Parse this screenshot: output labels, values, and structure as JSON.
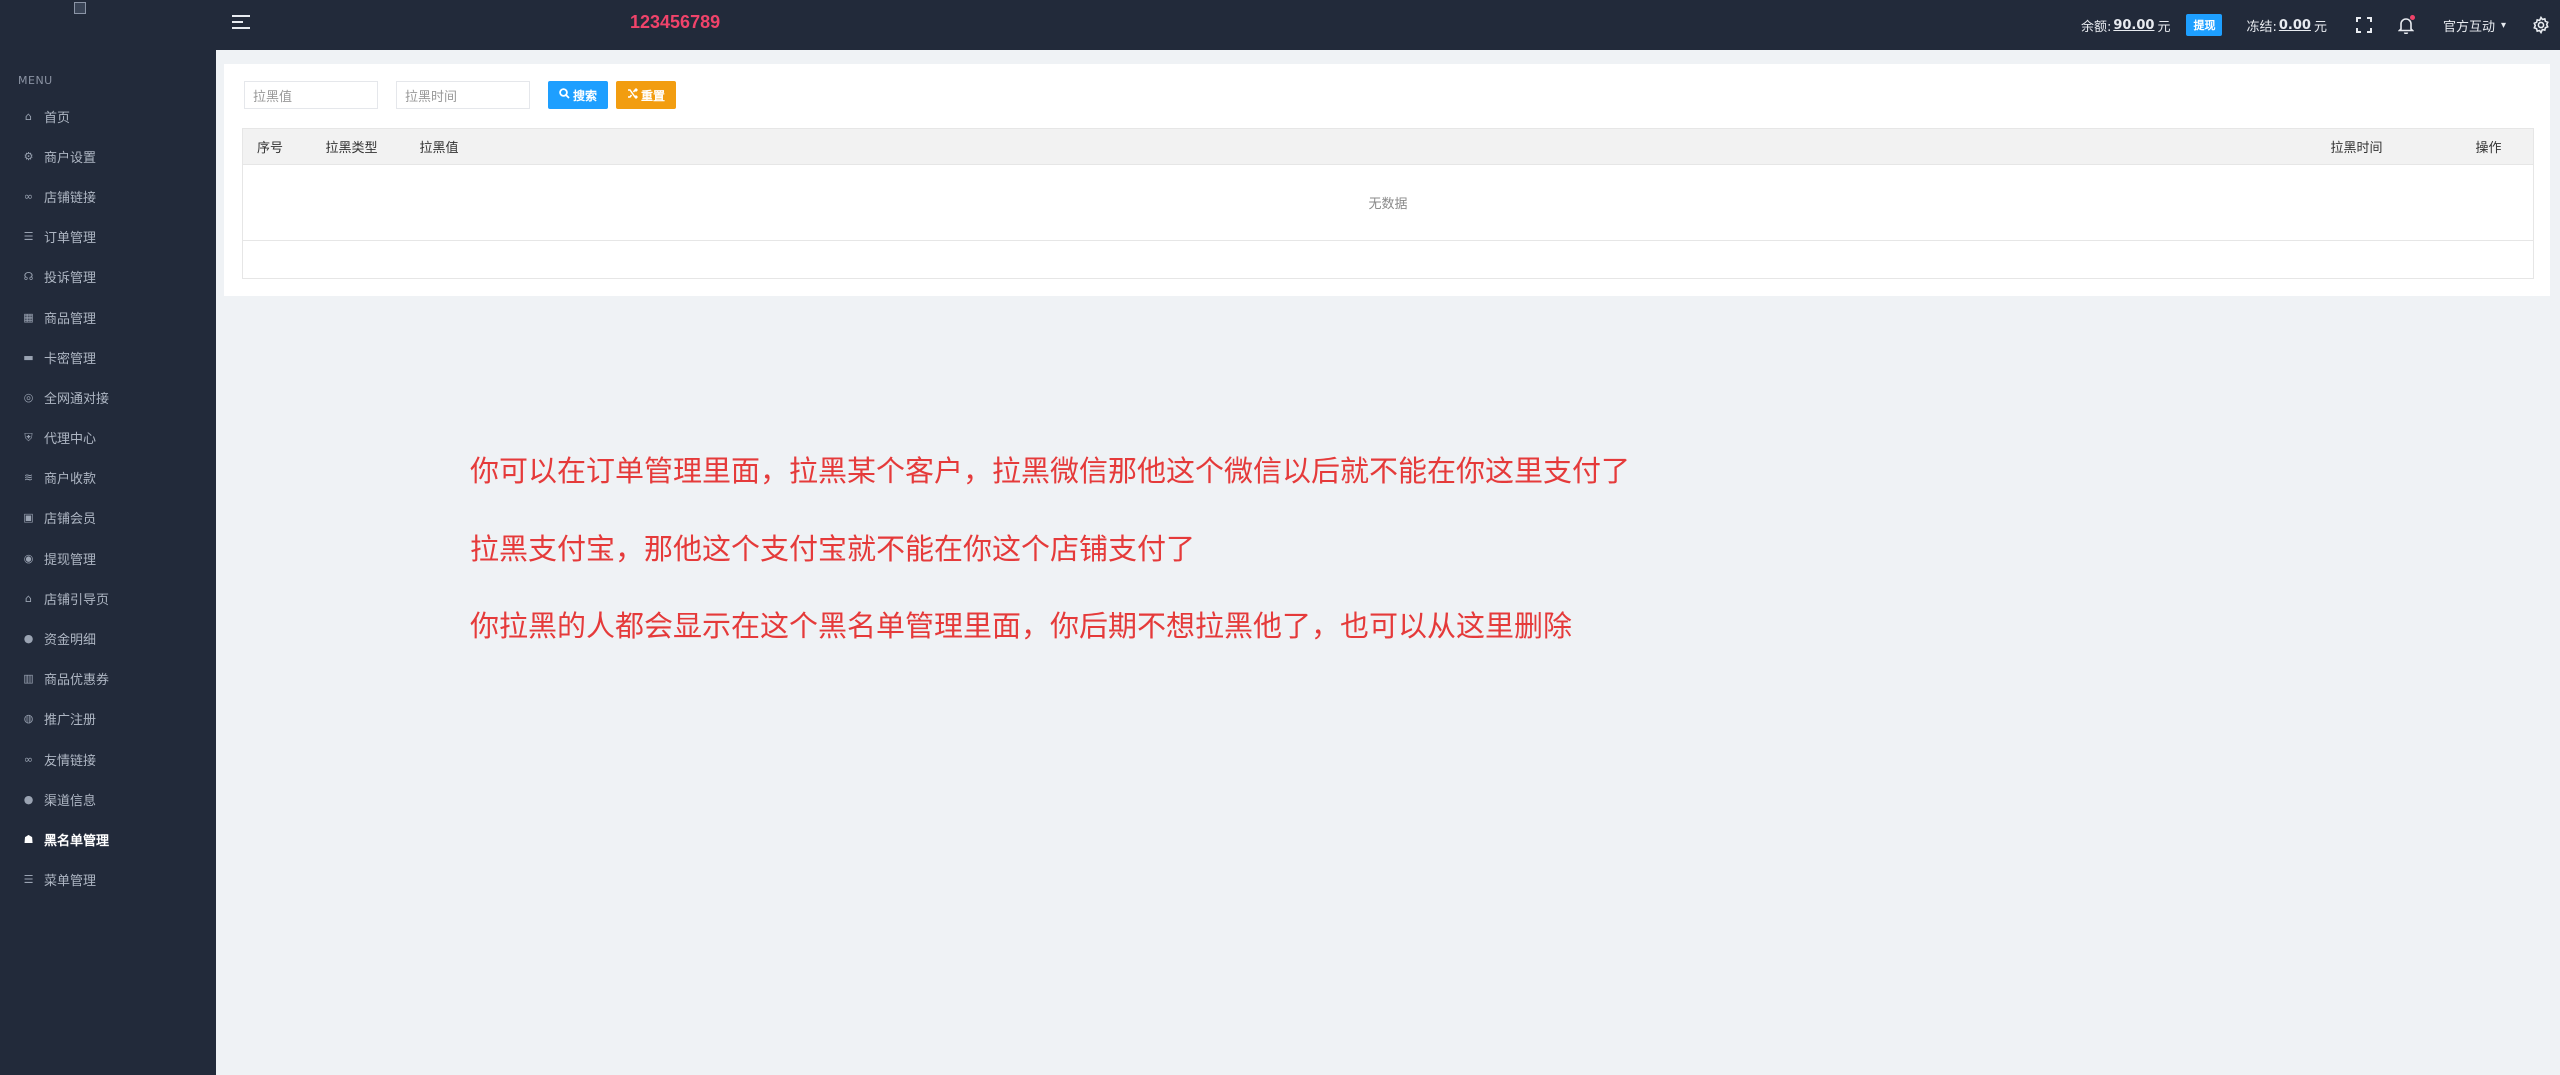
{
  "sidebar": {
    "menu_title": "MENU",
    "items": [
      {
        "label": "首页",
        "icon": "home-icon"
      },
      {
        "label": "商户设置",
        "icon": "gear-icon"
      },
      {
        "label": "店铺链接",
        "icon": "link-icon"
      },
      {
        "label": "订单管理",
        "icon": "list-icon"
      },
      {
        "label": "投诉管理",
        "icon": "headset-icon"
      },
      {
        "label": "商品管理",
        "icon": "grid-icon"
      },
      {
        "label": "卡密管理",
        "icon": "card-icon"
      },
      {
        "label": "全网通对接",
        "icon": "globe-icon"
      },
      {
        "label": "代理中心",
        "icon": "shield-icon"
      },
      {
        "label": "商户收款",
        "icon": "cash-icon"
      },
      {
        "label": "店铺会员",
        "icon": "member-icon"
      },
      {
        "label": "提现管理",
        "icon": "coin-icon"
      },
      {
        "label": "店铺引导页",
        "icon": "shop-icon"
      },
      {
        "label": "资金明细",
        "icon": "money-icon"
      },
      {
        "label": "商品优惠券",
        "icon": "coupon-icon"
      },
      {
        "label": "推广注册",
        "icon": "promo-icon"
      },
      {
        "label": "友情链接",
        "icon": "link-icon"
      },
      {
        "label": "渠道信息",
        "icon": "info-icon"
      },
      {
        "label": "黑名单管理",
        "icon": "blacklist-icon",
        "active": true
      },
      {
        "label": "菜单管理",
        "icon": "menu-icon"
      }
    ]
  },
  "header": {
    "brand_number": "123456789",
    "balance_label": "余额:",
    "balance_value": "90.00",
    "balance_unit": "元",
    "withdraw_label": "提现",
    "frozen_label": "冻结:",
    "frozen_value": "0.00",
    "frozen_unit": "元",
    "user_name": "官方互动"
  },
  "search": {
    "value_placeholder": "拉黑值",
    "time_placeholder": "拉黑时间",
    "search_label": "搜索",
    "reset_label": "重置"
  },
  "table": {
    "columns": [
      "序号",
      "拉黑类型",
      "拉黑值",
      "拉黑时间",
      "操作"
    ],
    "empty_text": "无数据"
  },
  "notes": [
    "你可以在订单管理里面，拉黑某个客户，拉黑微信那他这个微信以后就不能在你这里支付了",
    "拉黑支付宝，那他这个支付宝就不能在你这个店铺支付了",
    "你拉黑的人都会显示在这个黑名单管理里面，你后期不想拉黑他了，也可以从这里删除"
  ],
  "colors": {
    "sidebar_bg": "#222a3a",
    "brand_number": "#f0436a",
    "search_button": "#1e9fff",
    "reset_button": "#f29d10",
    "note_text": "#e53a3a"
  }
}
